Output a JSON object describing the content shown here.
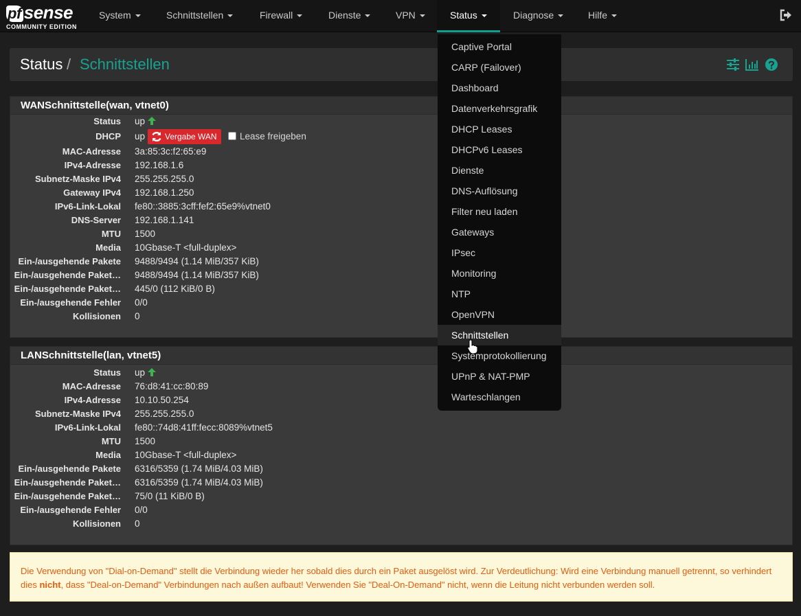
{
  "brand": {
    "pf": "pf",
    "sense": "sense",
    "sub": "COMMUNITY EDITION"
  },
  "nav": [
    {
      "label": "System"
    },
    {
      "label": "Schnittstellen"
    },
    {
      "label": "Firewall"
    },
    {
      "label": "Dienste"
    },
    {
      "label": "VPN"
    },
    {
      "label": "Status"
    },
    {
      "label": "Diagnose"
    },
    {
      "label": "Hilfe"
    }
  ],
  "header": {
    "root": "Status",
    "sep": "/",
    "current": "Schnittstellen"
  },
  "wan": {
    "title": "WANSchnittstelle(wan, vtnet0)",
    "rows": [
      {
        "label": "Status",
        "value": "up"
      },
      {
        "label": "DHCP",
        "value": "up"
      },
      {
        "label": "MAC-Adresse",
        "value": "3a:85:3c:f2:65:e9"
      },
      {
        "label": "IPv4-Adresse",
        "value": "192.168.1.6"
      },
      {
        "label": "Subnetz-Maske IPv4",
        "value": "255.255.255.0"
      },
      {
        "label": "Gateway IPv4",
        "value": "192.168.1.250"
      },
      {
        "label": "IPv6-Link-Lokal",
        "value": "fe80::3885:3cff:fef2:65e9%vtnet0"
      },
      {
        "label": "DNS-Server",
        "value": "192.168.1.141"
      },
      {
        "label": "MTU",
        "value": "1500"
      },
      {
        "label": "Media",
        "value": "10Gbase-T <full-duplex>"
      },
      {
        "label": "Ein-/ausgehende Pakete",
        "value": "9488/9494 (1.14 MiB/357 KiB)"
      },
      {
        "label": "Ein-/ausgehende Paket…",
        "value": "9488/9494 (1.14 MiB/357 KiB)"
      },
      {
        "label": "Ein-/ausgehende Paket…",
        "value": "445/0 (112 KiB/0 B)"
      },
      {
        "label": "Ein-/ausgehende Fehler",
        "value": "0/0"
      },
      {
        "label": "Kollisionen",
        "value": "0"
      }
    ],
    "renew_label": "Vergabe WAN",
    "release_label": "Lease freigeben"
  },
  "lan": {
    "title": "LANSchnittstelle(lan, vtnet5)",
    "rows": [
      {
        "label": "Status",
        "value": "up"
      },
      {
        "label": "MAC-Adresse",
        "value": "76:d8:41:cc:80:89"
      },
      {
        "label": "IPv4-Adresse",
        "value": "10.10.50.254"
      },
      {
        "label": "Subnetz-Maske IPv4",
        "value": "255.255.255.0"
      },
      {
        "label": "IPv6-Link-Lokal",
        "value": "fe80::74d8:41ff:fecc:8089%vtnet5"
      },
      {
        "label": "MTU",
        "value": "1500"
      },
      {
        "label": "Media",
        "value": "10Gbase-T <full-duplex>"
      },
      {
        "label": "Ein-/ausgehende Pakete",
        "value": "6316/5359 (1.74 MiB/4.03 MiB)"
      },
      {
        "label": "Ein-/ausgehende Paket…",
        "value": "6316/5359 (1.74 MiB/4.03 MiB)"
      },
      {
        "label": "Ein-/ausgehende Paket…",
        "value": "75/0 (11 KiB/0 B)"
      },
      {
        "label": "Ein-/ausgehende Fehler",
        "value": "0/0"
      },
      {
        "label": "Kollisionen",
        "value": "0"
      }
    ]
  },
  "alert": {
    "part1": "Die Verwendung von \"Dial-on-Demand\" stellt die Verbindung wieder her sobald dies durch ein Paket ausgelöst wird. Zur Verdeutlichung: Wird eine Verbindung manuell getrennt, so verhindert dies ",
    "bold": "nicht",
    "part2": ", dass \"Deal-on-Demand\" Verbindungen nach außen aufbaut! Verwenden Sie \"Deal-On-Demand\" nicht, wenn die Leitung nicht verbunden werden soll."
  },
  "status_menu": [
    "Captive Portal",
    "CARP (Failover)",
    "Dashboard",
    "Datenverkehrsgrafik",
    "DHCP Leases",
    "DHCPv6 Leases",
    "Dienste",
    "DNS-Auflösung",
    "Filter neu laden",
    "Gateways",
    "IPsec",
    "Monitoring",
    "NTP",
    "OpenVPN",
    "Schnittstellen",
    "Systemprotokollierung",
    "UPnP & NAT-PMP",
    "Warteschlangen"
  ],
  "colors": {
    "accent": "#17a391",
    "up": "#3fb34f",
    "danger": "#d9272e",
    "alert_text": "#e25d10",
    "alert_bg": "#fdf8d9"
  },
  "icons": {
    "logout": "sign-out-icon",
    "settings": "sliders-icon",
    "chart": "bar-chart-icon",
    "help": "question-circle-icon"
  }
}
